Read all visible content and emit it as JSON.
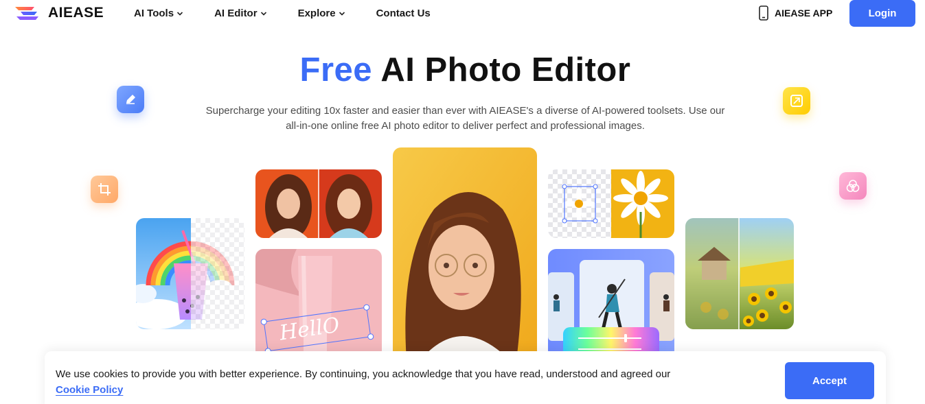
{
  "brand": {
    "name": "AIEASE",
    "accent": "#3b6cf6"
  },
  "nav": {
    "items": [
      {
        "label": "AI Tools",
        "has_dropdown": true
      },
      {
        "label": "AI Editor",
        "has_dropdown": true
      },
      {
        "label": "Explore",
        "has_dropdown": true
      },
      {
        "label": "Contact Us",
        "has_dropdown": false
      }
    ],
    "app_label": "AIEASE APP",
    "app_icon": "phone-icon",
    "login_label": "Login"
  },
  "hero": {
    "title_accent": "Free",
    "title_rest": "AI Photo Editor",
    "subtitle_line1": "Supercharge your editing 10x faster and easier than ever with AIEASE's a diverse of AI-powered toolsets. Use our",
    "subtitle_line2": "all-in-one online free AI photo editor to deliver perfect and professional images."
  },
  "floating_icons": [
    "pencil-edit-icon",
    "crop-icon",
    "resize-icon",
    "overlap-circles-icon"
  ],
  "gallery": {
    "hello_text": "HellO"
  },
  "cookie": {
    "text": "We use cookies to provide you with better experience. By continuing, you acknowledge that you have read, understood and agreed our",
    "link_label": "Cookie Policy",
    "accept_label": "Accept"
  }
}
